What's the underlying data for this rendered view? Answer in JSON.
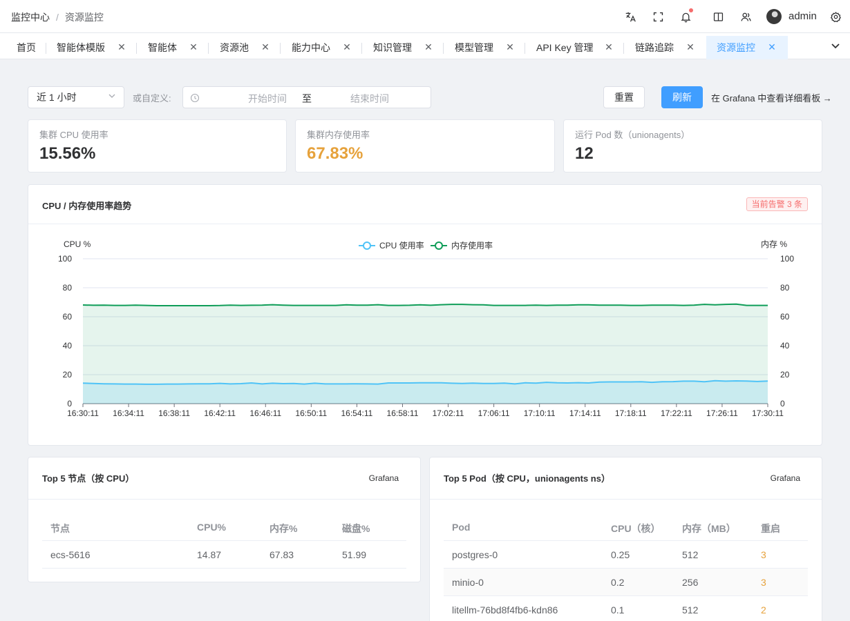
{
  "header": {
    "breadcrumb_root": "监控中心",
    "breadcrumb_separator": "/",
    "breadcrumb_current": "资源监控",
    "icons": [
      "translate-icon",
      "fullscreen-icon",
      "bell-icon",
      "book-icon",
      "users-icon",
      "settings-icon"
    ],
    "username": "admin"
  },
  "tabs": [
    {
      "label": "首页",
      "closable": false,
      "active": false
    },
    {
      "label": "智能体模版",
      "closable": true,
      "active": false
    },
    {
      "label": "智能体",
      "closable": true,
      "active": false
    },
    {
      "label": "资源池",
      "closable": true,
      "active": false
    },
    {
      "label": "能力中心",
      "closable": true,
      "active": false
    },
    {
      "label": "知识管理",
      "closable": true,
      "active": false
    },
    {
      "label": "模型管理",
      "closable": true,
      "active": false
    },
    {
      "label": "API Key 管理",
      "closable": true,
      "active": false
    },
    {
      "label": "链路追踪",
      "closable": true,
      "active": false
    },
    {
      "label": "资源监控",
      "closable": true,
      "active": true
    }
  ],
  "filters": {
    "range_selected": "近 1 小时",
    "custom_label": "或自定义:",
    "start_placeholder": "开始时间",
    "range_separator": "至",
    "end_placeholder": "结束时间",
    "reset_label": "重置",
    "refresh_label": "刷新",
    "grafana_link": "在 Grafana 中查看详细看板 →"
  },
  "stats": {
    "cpu_label": "集群 CPU 使用率",
    "cpu_value": "15.56%",
    "mem_label": "集群内存使用率",
    "mem_value": "67.83%",
    "pods_label": "运行 Pod 数（unionagents）",
    "pods_value": "12"
  },
  "trend": {
    "title": "CPU / 内存使用率趋势",
    "alert_badge": "当前告警 3 条"
  },
  "colors": {
    "primary": "#409eff",
    "cpu_line": "#4fc3f7",
    "mem_line": "#0f9d58",
    "warning": "#e6a23c",
    "danger": "#f56c6c"
  },
  "chart_data": {
    "type": "line",
    "ylabel_left": "CPU %",
    "ylabel_right": "内存 %",
    "ylim": [
      0,
      100
    ],
    "yticks": [
      0,
      20,
      40,
      60,
      80,
      100
    ],
    "grid": true,
    "legend_position": "top-center",
    "xtick_labels": [
      "16:30:11",
      "16:34:11",
      "16:38:11",
      "16:42:11",
      "16:46:11",
      "16:50:11",
      "16:54:11",
      "16:58:11",
      "17:02:11",
      "17:06:11",
      "17:10:11",
      "17:14:11",
      "17:18:11",
      "17:22:11",
      "17:26:11",
      "17:30:11"
    ],
    "series": [
      {
        "name": "CPU 使用率",
        "color": "#4fc3f7",
        "area": true,
        "values": [
          14.2,
          13.9,
          13.7,
          13.6,
          13.5,
          13.5,
          13.4,
          13.4,
          13.5,
          13.5,
          13.6,
          13.7,
          13.7,
          14.0,
          13.6,
          13.8,
          14.3,
          13.6,
          14.1,
          13.8,
          13.9,
          13.5,
          14.1,
          13.6,
          13.6,
          13.6,
          13.7,
          13.6,
          13.5,
          14.3,
          14.3,
          14.3,
          14.4,
          14.4,
          14.4,
          14.1,
          13.9,
          14.2,
          13.9,
          13.9,
          14.2,
          13.6,
          14.4,
          14.2,
          14.7,
          14.4,
          14.3,
          14.5,
          14.3,
          14.9,
          15.0,
          15.0,
          15.0,
          15.1,
          14.7,
          15.1,
          15.2,
          15.5,
          15.5,
          15.1,
          15.8,
          15.5,
          15.7,
          15.6,
          15.3,
          15.6
        ]
      },
      {
        "name": "内存使用率",
        "color": "#0f9d58",
        "area": true,
        "values": [
          68.1,
          67.9,
          68.0,
          67.8,
          67.8,
          68.0,
          67.8,
          67.6,
          67.6,
          67.6,
          67.6,
          67.6,
          67.6,
          67.7,
          68.0,
          67.8,
          67.9,
          68.0,
          68.3,
          68.0,
          67.8,
          67.8,
          67.8,
          67.8,
          67.8,
          68.2,
          68.0,
          68.0,
          68.3,
          67.8,
          67.8,
          67.9,
          68.2,
          67.9,
          68.3,
          68.5,
          68.5,
          68.3,
          68.2,
          67.8,
          67.8,
          67.8,
          67.8,
          68.0,
          67.8,
          68.0,
          68.0,
          68.2,
          68.2,
          68.0,
          68.0,
          68.0,
          67.8,
          67.8,
          68.0,
          68.0,
          68.0,
          67.8,
          68.0,
          68.5,
          68.2,
          68.5,
          68.7,
          67.8,
          67.8,
          67.8
        ]
      }
    ]
  },
  "top_nodes": {
    "title": "Top 5 节点（按 CPU）",
    "link": "Grafana",
    "columns": [
      "节点",
      "CPU%",
      "内存%",
      "磁盘%"
    ],
    "rows": [
      [
        "ecs-5616",
        "14.87",
        "67.83",
        "51.99"
      ]
    ]
  },
  "top_pods": {
    "title": "Top 5 Pod（按 CPU，unionagents ns）",
    "link": "Grafana",
    "columns": [
      "Pod",
      "CPU（核）",
      "内存（MB）",
      "重启"
    ],
    "rows": [
      [
        "postgres-0",
        "0.25",
        "512",
        "3"
      ],
      [
        "minio-0",
        "0.2",
        "256",
        "3"
      ],
      [
        "litellm-76bd8f4fb6-kdn86",
        "0.1",
        "512",
        "2"
      ]
    ]
  }
}
